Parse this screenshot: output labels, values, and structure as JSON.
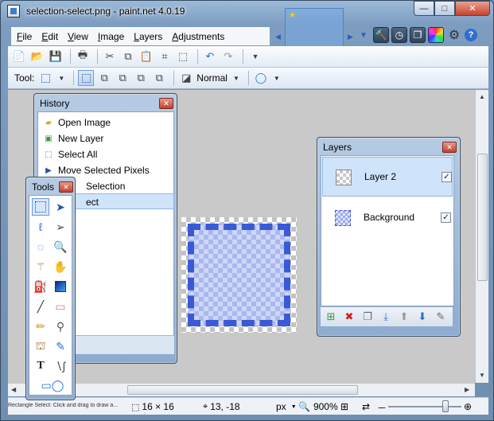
{
  "window": {
    "title": "selection-select.png - paint.net 4.0.19"
  },
  "title_buttons": {
    "minimize": "—",
    "maximize": "□",
    "close": "✕"
  },
  "menu": [
    {
      "label": "File",
      "key": "F",
      "rest": "ile"
    },
    {
      "label": "Edit",
      "key": "E",
      "rest": "dit"
    },
    {
      "label": "View",
      "key": "V",
      "rest": "iew"
    },
    {
      "label": "Image",
      "key": "I",
      "rest": "mage"
    },
    {
      "label": "Layers",
      "key": "L",
      "rest": "ayers"
    },
    {
      "label": "Adjustments",
      "key": "A",
      "rest": "djustments"
    }
  ],
  "toolbar2": {
    "tool_label": "Tool:",
    "blend_mode": "Normal"
  },
  "history": {
    "title": "History",
    "items": [
      {
        "label": "Open Image",
        "icon": "folder-icon"
      },
      {
        "label": "New Layer",
        "icon": "new-layer-icon"
      },
      {
        "label": "Select All",
        "icon": "select-all-icon"
      },
      {
        "label": "Move Selected Pixels",
        "icon": "move-icon"
      },
      {
        "label": "Selection",
        "icon": "selection-icon"
      },
      {
        "label": "ect",
        "icon": "select-icon"
      }
    ]
  },
  "tools": {
    "title": "Tools"
  },
  "layers": {
    "title": "Layers",
    "items": [
      {
        "name": "Layer 2",
        "visible": true,
        "selected": true
      },
      {
        "name": "Background",
        "visible": true,
        "selected": false
      }
    ]
  },
  "status": {
    "hint": "Rectangle Select: Click and drag to draw a...",
    "size": "16 × 16",
    "position": "13, -18",
    "units": "px",
    "zoom": "900%"
  },
  "icons": {
    "help": "?",
    "gear": "⚙"
  },
  "colors": {
    "accent": "#3a5ad5",
    "selection": "#cfe3fa",
    "close_red": "#c8432d"
  }
}
